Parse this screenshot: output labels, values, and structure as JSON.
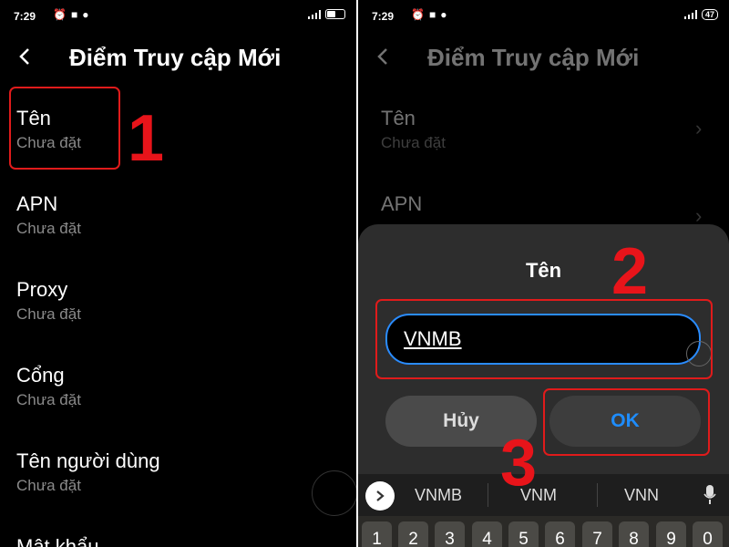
{
  "left": {
    "status": {
      "time": "7:29"
    },
    "title": "Điểm Truy cập Mới",
    "items": [
      {
        "label": "Tên",
        "sub": "Chưa đặt"
      },
      {
        "label": "APN",
        "sub": "Chưa đặt"
      },
      {
        "label": "Proxy",
        "sub": "Chưa đặt"
      },
      {
        "label": "Cổng",
        "sub": "Chưa đặt"
      },
      {
        "label": "Tên người dùng",
        "sub": "Chưa đặt"
      },
      {
        "label": "Mật khẩu",
        "sub": ""
      }
    ],
    "step": "1"
  },
  "right": {
    "status": {
      "time": "7:29",
      "battery": "47"
    },
    "title": "Điểm Truy cập Mới",
    "items": [
      {
        "label": "Tên",
        "sub": "Chưa đặt"
      },
      {
        "label": "APN",
        "sub": ""
      }
    ],
    "dialog": {
      "title": "Tên",
      "input_value": "VNMB",
      "cancel_label": "Hủy",
      "ok_label": "OK"
    },
    "suggestions": [
      "VNMB",
      "VNM",
      "VNN"
    ],
    "keys": [
      "1",
      "2",
      "3",
      "4",
      "5",
      "6",
      "7",
      "8",
      "9",
      "0"
    ],
    "steps": [
      "2",
      "3"
    ]
  },
  "colors": {
    "highlight": "#e01b1b",
    "accent": "#1e8dff",
    "background": "#000000"
  }
}
